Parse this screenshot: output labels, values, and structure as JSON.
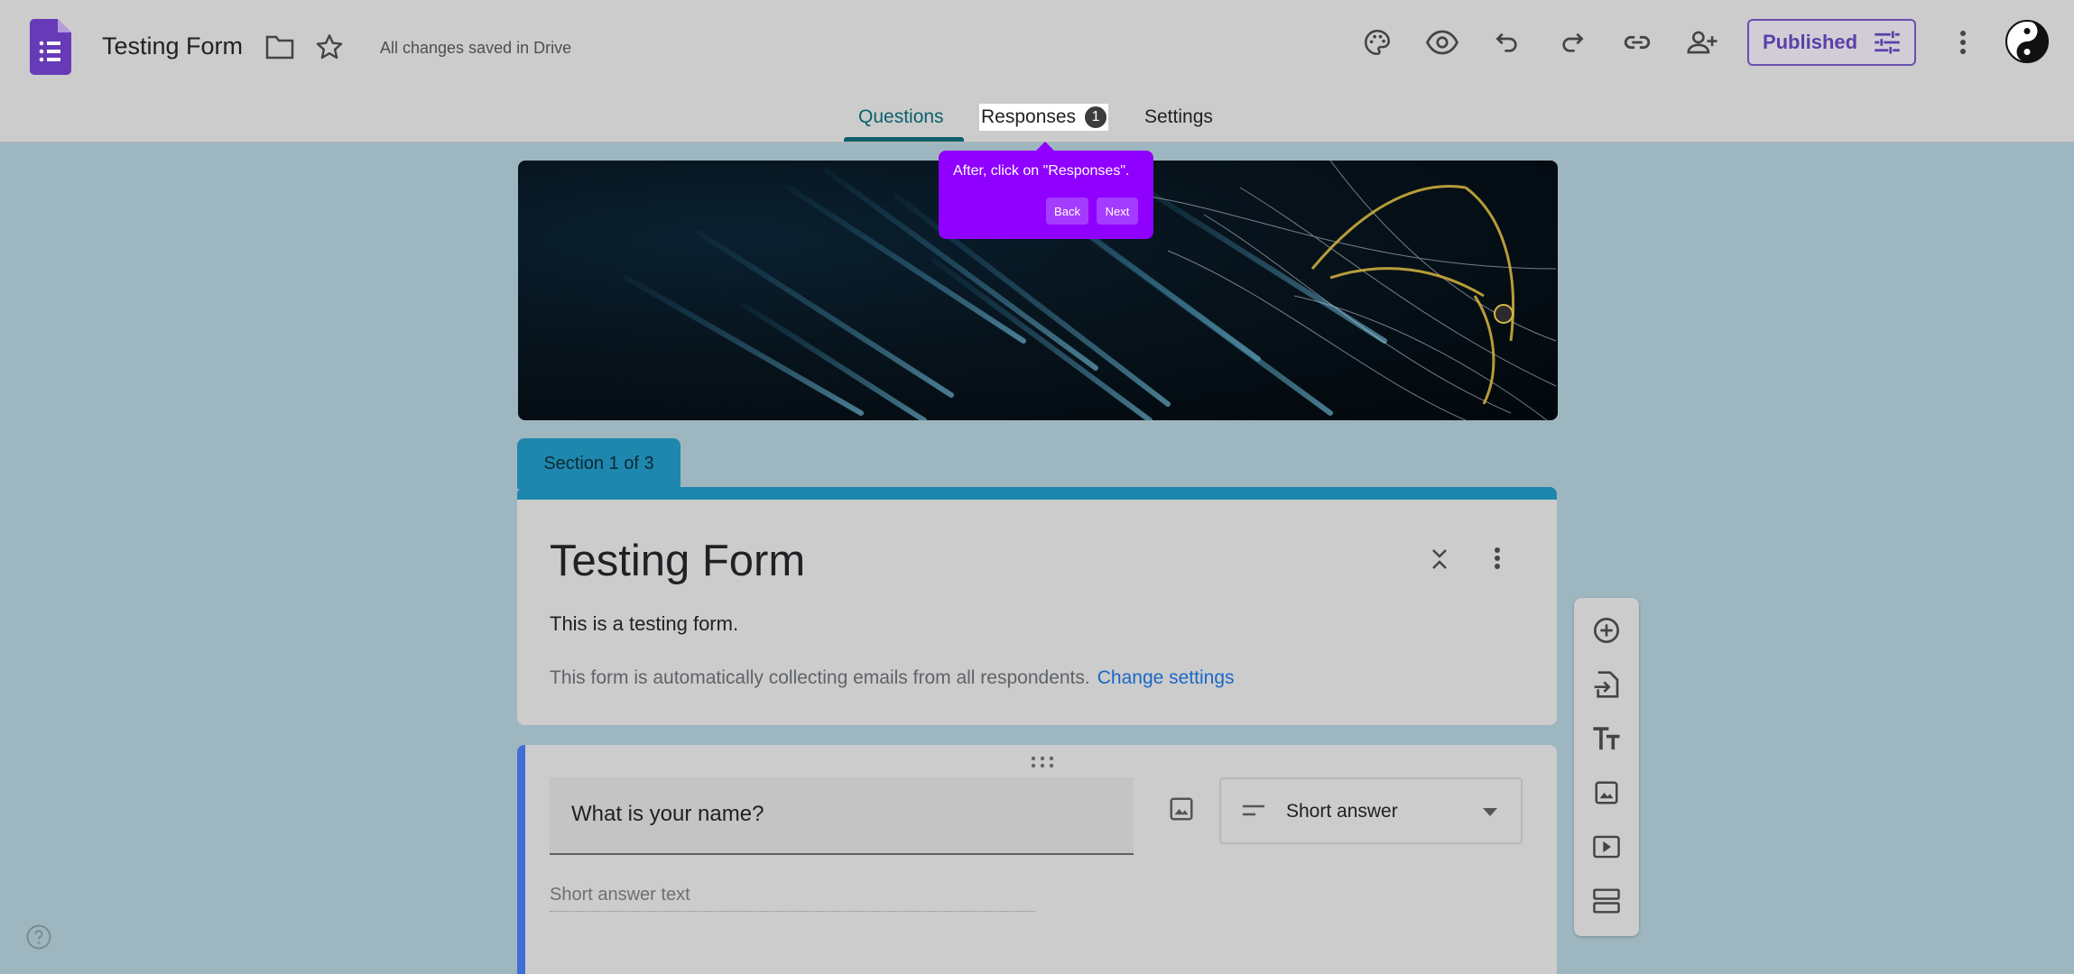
{
  "header": {
    "form_title": "Testing Form",
    "save_status": "All changes saved in Drive",
    "published_label": "Published",
    "icons": [
      "forms-app-icon",
      "folder-icon",
      "star-icon",
      "palette-icon",
      "preview-eye-icon",
      "undo-icon",
      "redo-icon",
      "link-icon",
      "add-collaborator-icon",
      "publish-settings-icon",
      "more-vert-icon",
      "yin-yang-avatar-icon"
    ]
  },
  "tabs": {
    "questions": "Questions",
    "responses": "Responses",
    "responses_count": "1",
    "settings": "Settings"
  },
  "tooltip": {
    "text": "After, click on \"Responses\".",
    "back": "Back",
    "next": "Next"
  },
  "section": {
    "label": "Section 1 of 3",
    "title": "Testing Form",
    "description": "This is a testing form.",
    "email_notice": "This form is automatically collecting emails from all respondents.",
    "change_settings": "Change settings"
  },
  "question": {
    "title": "What is your name?",
    "type": "Short answer",
    "answer_placeholder": "Short answer text"
  },
  "colors": {
    "accent": "#1e87ad",
    "tooltip": "#8f00ff",
    "published": "#5b3fa8",
    "link": "#1a67c9"
  }
}
